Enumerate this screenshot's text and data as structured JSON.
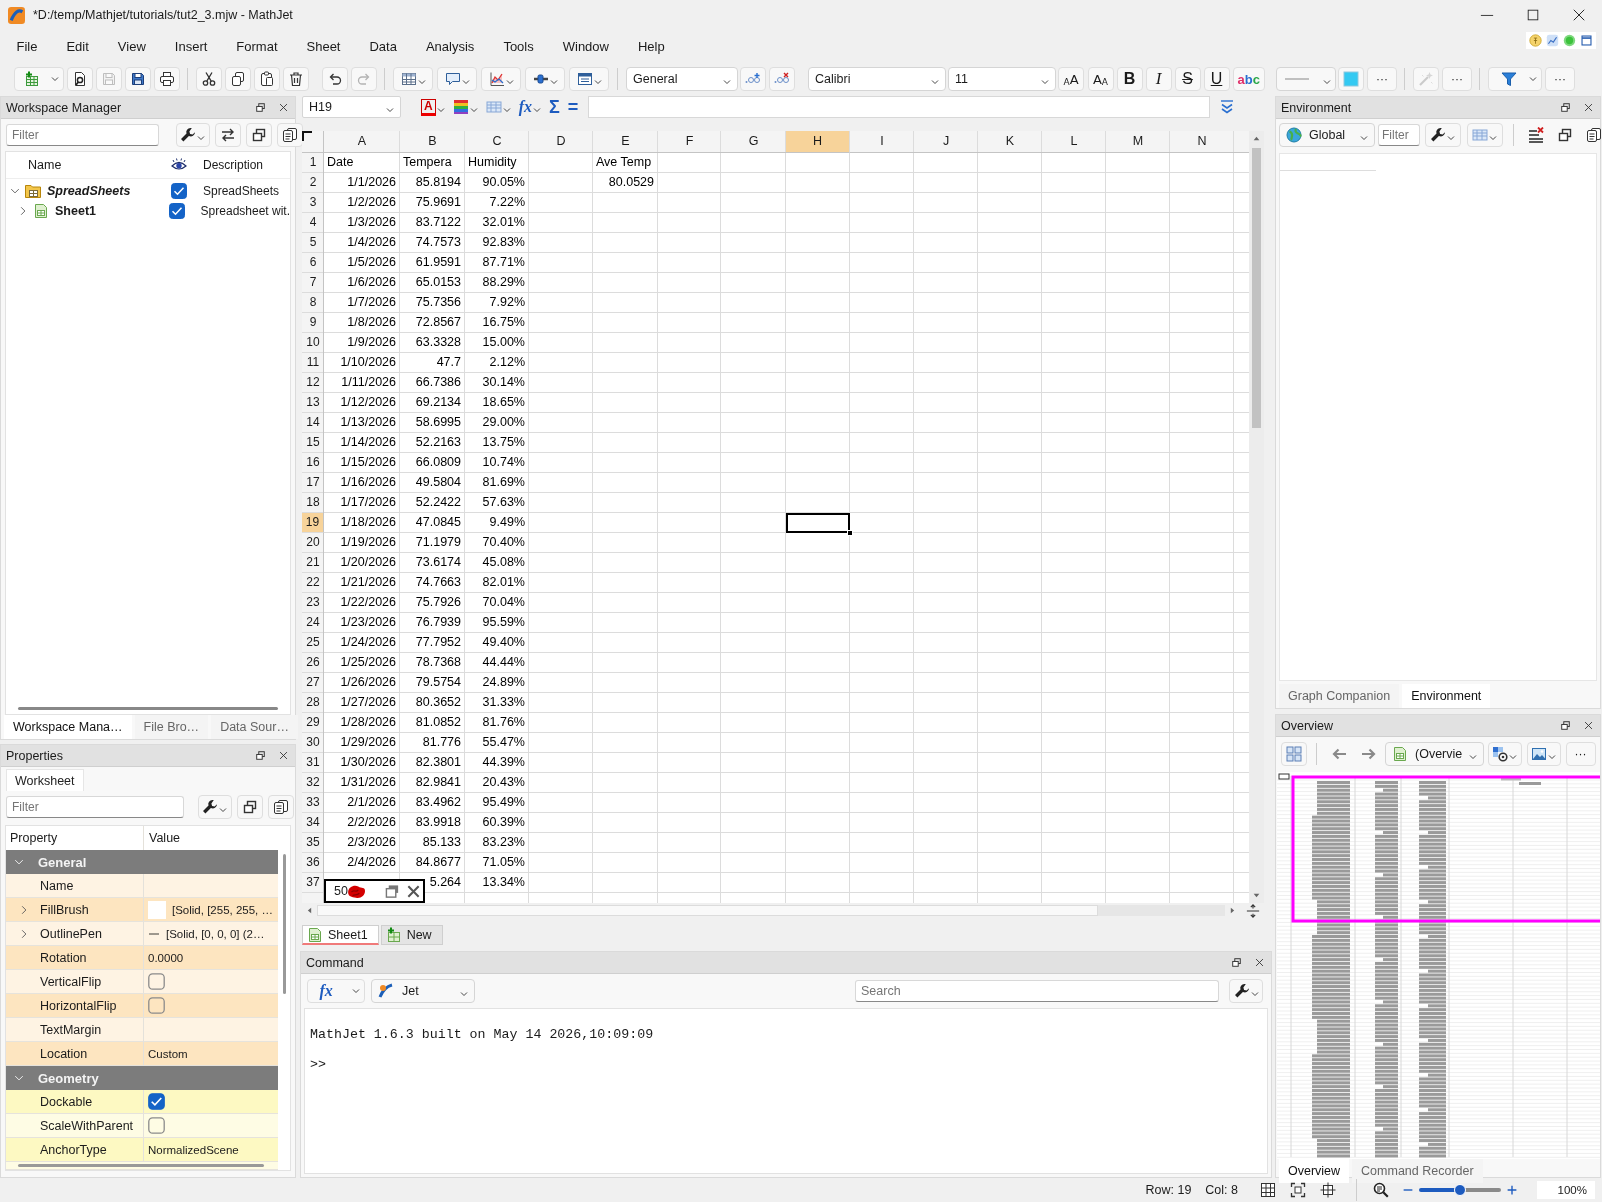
{
  "window": {
    "title": "*D:/temp/Mathjet/tutorials/tut2_3.mjw - MathJet"
  },
  "menu": [
    "File",
    "Edit",
    "View",
    "Insert",
    "Format",
    "Sheet",
    "Data",
    "Analysis",
    "Tools",
    "Window",
    "Help"
  ],
  "toolbar": {
    "buttons": [
      {
        "disabled": false
      },
      {
        "disabled": false
      },
      {
        "disabled": true
      },
      {
        "disabled": false
      },
      {
        "disabled": false
      },
      {
        "disabled": false
      },
      {
        "disabled": false
      },
      {
        "disabled": false
      },
      {
        "disabled": false
      },
      {
        "disabled": false
      },
      {
        "disabled": true
      }
    ],
    "number_format": "General",
    "font": "Calibri",
    "font_size": "11",
    "style_buttons": [
      {
        "label": "AA",
        "kind": "grow"
      },
      {
        "label": "AA",
        "kind": "shrink"
      },
      {
        "label": "B",
        "kind": "bold"
      },
      {
        "label": "I",
        "kind": "italic"
      },
      {
        "label": "S",
        "kind": "strike"
      },
      {
        "label": "U",
        "kind": "underline"
      },
      {
        "label": "abc",
        "kind": "spell"
      }
    ],
    "more_buttons": [
      "···",
      "···",
      "···"
    ],
    "tool_buttons": [
      {
        "disabled": true
      },
      {
        "disabled": false
      }
    ]
  },
  "formula_bar": {
    "cell": "H19",
    "font_color_label": "A",
    "function_label": "fx",
    "sum_label": "Σ",
    "equals_label": "="
  },
  "workspace": {
    "title": "Workspace Manager",
    "filter": {
      "placeholder": "Filter"
    },
    "columns": [
      "Name",
      "Description"
    ],
    "tree": [
      {
        "name": "SpreadSheets",
        "kind": "folder",
        "checked": true,
        "description": "SpreadSheets",
        "expanded": true,
        "children": [
          {
            "name": "Sheet1",
            "kind": "sheet",
            "checked": true,
            "description": "Spreadsheet wit.",
            "expanded": false
          }
        ]
      }
    ],
    "tabs": [
      {
        "label": "Workspace Mana…",
        "selected": true
      },
      {
        "label": "File Bro…",
        "selected": false
      },
      {
        "label": "Data Sour…",
        "selected": false
      }
    ]
  },
  "properties": {
    "title": "Properties",
    "tabs": [
      {
        "label": "Worksheet",
        "selected": true
      }
    ],
    "filter": {
      "placeholder": "Filter"
    },
    "columns": [
      "Property",
      "Value"
    ],
    "groups": [
      {
        "name": "General",
        "expanded": true,
        "color": "#fde5c0",
        "rows": [
          {
            "name": "Name",
            "kind": "text"
          },
          {
            "name": "FillBrush",
            "kind": "brush",
            "expanded": false,
            "color": "#ffffff",
            "value": "[Solid, [255, 255, …"
          },
          {
            "name": "OutlinePen",
            "kind": "pen",
            "expanded": false,
            "value": "[Solid, [0, 0, 0] (2…"
          },
          {
            "name": "Rotation",
            "kind": "text",
            "value": "0.0000"
          },
          {
            "name": "VerticalFlip",
            "kind": "check",
            "checked": false
          },
          {
            "name": "HorizontalFlip",
            "kind": "check",
            "checked": false
          },
          {
            "name": "TextMargin",
            "kind": "text"
          },
          {
            "name": "Location",
            "kind": "text",
            "value": "Custom"
          }
        ]
      },
      {
        "name": "Geometry",
        "expanded": true,
        "color": "#fdf9c2",
        "rows": [
          {
            "name": "Dockable",
            "kind": "check",
            "checked": true
          },
          {
            "name": "ScaleWithParent",
            "kind": "check",
            "checked": false
          },
          {
            "name": "AnchorType",
            "kind": "text",
            "value": "NormalizedScene"
          }
        ]
      }
    ]
  },
  "sheet": {
    "columns": [
      {
        "label": "A",
        "selected": false
      },
      {
        "label": "B",
        "selected": false
      },
      {
        "label": "C",
        "selected": false
      },
      {
        "label": "D",
        "selected": false
      },
      {
        "label": "E",
        "selected": false
      },
      {
        "label": "F",
        "selected": false
      },
      {
        "label": "G",
        "selected": false
      },
      {
        "label": "H",
        "selected": true
      },
      {
        "label": "I",
        "selected": false
      },
      {
        "label": "J",
        "selected": false
      },
      {
        "label": "K",
        "selected": false
      },
      {
        "label": "L",
        "selected": false
      },
      {
        "label": "M",
        "selected": false
      },
      {
        "label": "N",
        "selected": false
      }
    ],
    "rows": [
      {
        "n": "1",
        "selected": false,
        "kind": "labels",
        "cells": [
          "Date",
          "Tempera",
          "Humidity",
          null,
          "Ave Temp"
        ]
      },
      {
        "n": "2",
        "selected": false,
        "kind": "values",
        "cells": [
          "1/1/2026",
          "85.8194",
          "90.05%",
          null,
          "80.0529"
        ]
      },
      {
        "n": "3",
        "selected": false,
        "kind": "values",
        "cells": [
          "1/2/2026",
          "75.9691",
          "7.22%"
        ]
      },
      {
        "n": "4",
        "selected": false,
        "kind": "values",
        "cells": [
          "1/3/2026",
          "83.7122",
          "32.01%"
        ]
      },
      {
        "n": "5",
        "selected": false,
        "kind": "values",
        "cells": [
          "1/4/2026",
          "74.7573",
          "92.83%"
        ]
      },
      {
        "n": "6",
        "selected": false,
        "kind": "values",
        "cells": [
          "1/5/2026",
          "61.9591",
          "87.71%"
        ]
      },
      {
        "n": "7",
        "selected": false,
        "kind": "values",
        "cells": [
          "1/6/2026",
          "65.0153",
          "88.29%"
        ]
      },
      {
        "n": "8",
        "selected": false,
        "kind": "values",
        "cells": [
          "1/7/2026",
          "75.7356",
          "7.92%"
        ]
      },
      {
        "n": "9",
        "selected": false,
        "kind": "values",
        "cells": [
          "1/8/2026",
          "72.8567",
          "16.75%"
        ]
      },
      {
        "n": "10",
        "selected": false,
        "kind": "values",
        "cells": [
          "1/9/2026",
          "63.3328",
          "15.00%"
        ]
      },
      {
        "n": "11",
        "selected": false,
        "kind": "values",
        "cells": [
          "1/10/2026",
          "47.7",
          "2.12%"
        ]
      },
      {
        "n": "12",
        "selected": false,
        "kind": "values",
        "cells": [
          "1/11/2026",
          "66.7386",
          "30.14%"
        ]
      },
      {
        "n": "13",
        "selected": false,
        "kind": "values",
        "cells": [
          "1/12/2026",
          "69.2134",
          "18.65%"
        ]
      },
      {
        "n": "14",
        "selected": false,
        "kind": "values",
        "cells": [
          "1/13/2026",
          "58.6995",
          "29.00%"
        ]
      },
      {
        "n": "15",
        "selected": false,
        "kind": "values",
        "cells": [
          "1/14/2026",
          "52.2163",
          "13.75%"
        ]
      },
      {
        "n": "16",
        "selected": false,
        "kind": "values",
        "cells": [
          "1/15/2026",
          "66.0809",
          "10.74%"
        ]
      },
      {
        "n": "17",
        "selected": false,
        "kind": "values",
        "cells": [
          "1/16/2026",
          "49.5804",
          "81.69%"
        ]
      },
      {
        "n": "18",
        "selected": false,
        "kind": "values",
        "cells": [
          "1/17/2026",
          "52.2422",
          "57.63%"
        ]
      },
      {
        "n": "19",
        "selected": true,
        "kind": "values",
        "cells": [
          "1/18/2026",
          "47.0845",
          "9.49%"
        ]
      },
      {
        "n": "20",
        "selected": false,
        "kind": "values",
        "cells": [
          "1/19/2026",
          "71.1979",
          "70.40%"
        ]
      },
      {
        "n": "21",
        "selected": false,
        "kind": "values",
        "cells": [
          "1/20/2026",
          "73.6174",
          "45.08%"
        ]
      },
      {
        "n": "22",
        "selected": false,
        "kind": "values",
        "cells": [
          "1/21/2026",
          "74.7663",
          "82.01%"
        ]
      },
      {
        "n": "23",
        "selected": false,
        "kind": "values",
        "cells": [
          "1/22/2026",
          "75.7926",
          "70.04%"
        ]
      },
      {
        "n": "24",
        "selected": false,
        "kind": "values",
        "cells": [
          "1/23/2026",
          "76.7939",
          "95.59%"
        ]
      },
      {
        "n": "25",
        "selected": false,
        "kind": "values",
        "cells": [
          "1/24/2026",
          "77.7952",
          "49.40%"
        ]
      },
      {
        "n": "26",
        "selected": false,
        "kind": "values",
        "cells": [
          "1/25/2026",
          "78.7368",
          "44.44%"
        ]
      },
      {
        "n": "27",
        "selected": false,
        "kind": "values",
        "cells": [
          "1/26/2026",
          "79.5754",
          "24.89%"
        ]
      },
      {
        "n": "28",
        "selected": false,
        "kind": "values",
        "cells": [
          "1/27/2026",
          "80.3652",
          "31.33%"
        ]
      },
      {
        "n": "29",
        "selected": false,
        "kind": "values",
        "cells": [
          "1/28/2026",
          "81.0852",
          "81.76%"
        ]
      },
      {
        "n": "30",
        "selected": false,
        "kind": "values",
        "cells": [
          "1/29/2026",
          "81.776",
          "55.47%"
        ]
      },
      {
        "n": "31",
        "selected": false,
        "kind": "values",
        "cells": [
          "1/30/2026",
          "82.3801",
          "44.39%"
        ]
      },
      {
        "n": "32",
        "selected": false,
        "kind": "values",
        "cells": [
          "1/31/2026",
          "82.9841",
          "20.43%"
        ]
      },
      {
        "n": "33",
        "selected": false,
        "kind": "values",
        "cells": [
          "2/1/2026",
          "83.4962",
          "95.49%"
        ]
      },
      {
        "n": "34",
        "selected": false,
        "kind": "values",
        "cells": [
          "2/2/2026",
          "83.9918",
          "60.39%"
        ]
      },
      {
        "n": "35",
        "selected": false,
        "kind": "values",
        "cells": [
          "2/3/2026",
          "85.133",
          "83.23%"
        ]
      },
      {
        "n": "36",
        "selected": false,
        "kind": "values",
        "cells": [
          "2/4/2026",
          "84.8677",
          "71.05%"
        ]
      },
      {
        "n": "37",
        "selected": false,
        "kind": "values",
        "cells": [
          null,
          "5.264",
          "13.34%"
        ]
      }
    ],
    "floating_object": {
      "text": "50"
    },
    "tabs": [
      {
        "label": "Sheet1",
        "kind": "sheet",
        "selected": true
      },
      {
        "label": "New",
        "kind": "new",
        "selected": false
      }
    ]
  },
  "command": {
    "title": "Command",
    "function_label": "fx",
    "language": "Jet",
    "search": {
      "placeholder": "Search"
    },
    "output": [
      "MathJet 1.6.3 built on May 14 2026,10:09:09",
      ">>"
    ]
  },
  "environment": {
    "title": "Environment",
    "scope": "Global",
    "filter": {
      "placeholder": "Filter"
    },
    "tabs": [
      {
        "label": "Graph Companion",
        "selected": false
      },
      {
        "label": "Environment",
        "selected": true
      }
    ]
  },
  "overview": {
    "title": "Overview",
    "view": "(Overvie",
    "more": "···",
    "tabs": [
      {
        "label": "Overview",
        "selected": true
      },
      {
        "label": "Command Recorder",
        "selected": false
      }
    ]
  },
  "status_bar": {
    "row": "Row: 19",
    "col": "Col: 8",
    "zoom": {
      "level": 0.5,
      "reading": "100%"
    }
  }
}
